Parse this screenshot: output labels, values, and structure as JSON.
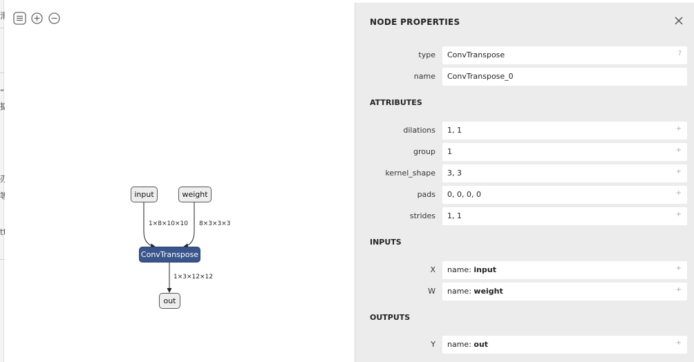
{
  "toolbar": {
    "items": [
      {
        "name": "sidebar-toggle-icon"
      },
      {
        "name": "zoom-in-icon"
      },
      {
        "name": "zoom-out-icon"
      }
    ]
  },
  "background_fragments": [
    "滑",
    "“",
    "掂",
    "刅",
    "等",
    "tt"
  ],
  "graph": {
    "nodes": {
      "input": "input",
      "weight": "weight",
      "conv": "ConvTranspose",
      "out": "out"
    },
    "edges": {
      "input_shape": "1×8×10×10",
      "weight_shape": "8×3×3×3",
      "out_shape": "1×3×12×12"
    },
    "colors": {
      "op_node": "#39558b",
      "io_node": "#eeeeee"
    }
  },
  "panel": {
    "title": "NODE PROPERTIES",
    "properties": [
      {
        "label": "type",
        "value": "ConvTranspose",
        "expander": "?"
      },
      {
        "label": "name",
        "value": "ConvTranspose_0",
        "expander": ""
      }
    ],
    "attributes_title": "ATTRIBUTES",
    "attributes": [
      {
        "label": "dilations",
        "value": "1, 1",
        "expander": "+"
      },
      {
        "label": "group",
        "value": "1",
        "expander": "+"
      },
      {
        "label": "kernel_shape",
        "value": "3, 3",
        "expander": "+"
      },
      {
        "label": "pads",
        "value": "0, 0, 0, 0",
        "expander": "+"
      },
      {
        "label": "strides",
        "value": "1, 1",
        "expander": "+"
      }
    ],
    "inputs_title": "INPUTS",
    "inputs": [
      {
        "label": "X",
        "prefix": "name: ",
        "value": "input",
        "expander": "+"
      },
      {
        "label": "W",
        "prefix": "name: ",
        "value": "weight",
        "expander": "+"
      }
    ],
    "outputs_title": "OUTPUTS",
    "outputs": [
      {
        "label": "Y",
        "prefix": "name: ",
        "value": "out",
        "expander": "+"
      }
    ]
  }
}
